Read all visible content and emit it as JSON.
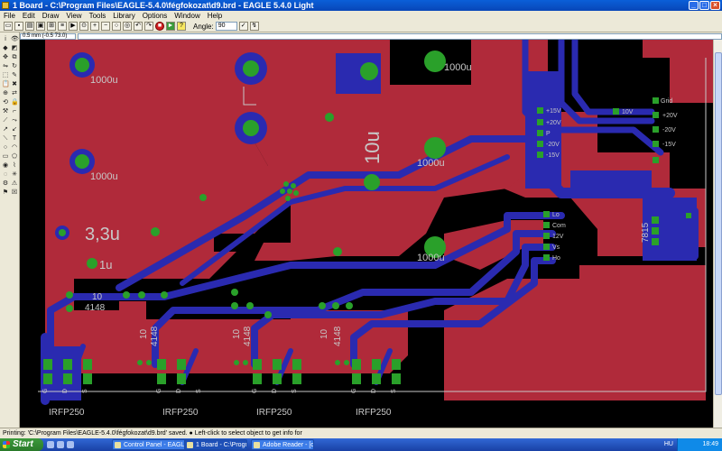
{
  "window": {
    "title": "1 Board - C:\\Program Files\\EAGLE-5.4.0\\fégfokozat\\d9.brd - EAGLE 5.4.0 Light"
  },
  "menu": [
    "File",
    "Edit",
    "Draw",
    "View",
    "Tools",
    "Library",
    "Options",
    "Window",
    "Help"
  ],
  "toolbar": {
    "angle_label": "Angle:",
    "angle_value": "90",
    "icons": [
      "open-icon",
      "save-icon",
      "print-icon",
      "cam-icon",
      "schematic-icon",
      "script-icon",
      "run-icon",
      "zoom-fit-icon",
      "zoom-in-icon",
      "zoom-out-icon",
      "zoom-redraw-icon",
      "zoom-select-icon",
      "undo-icon",
      "redo-icon",
      "stop-icon",
      "go-icon",
      "help-icon",
      "drc-icon",
      "erc-icon"
    ]
  },
  "coordinates": {
    "display": "0.5 mm (-0.5 73.0)"
  },
  "status": {
    "text": "Printing: 'C:\\Program Files\\EAGLE-5.4.0\\fégfokozat\\d9.brd' saved.   ● Left-click to select object to get info for"
  },
  "taskbar": {
    "start_label": "Start",
    "tasks": [
      "Control Panel - EAGL...",
      "1 Board - C:\\Program ...",
      "Adobe Reader - [dat..."
    ],
    "language": "HU",
    "clock": "18:49"
  },
  "pcb": {
    "colors": {
      "background": "#000000",
      "top_copper": "#b02a3a",
      "bottom_copper": "#2a2ab0",
      "pad": "#2aa02a",
      "label": "#c8c8c8"
    },
    "labels": {
      "cap_1000u_a": "1000u",
      "cap_1000u_b": "1000u",
      "cap_1000u_c": "1000u",
      "cap_1000u_d": "1000u",
      "cap_1000u_e": "1000u",
      "cap_10u": "10u",
      "cap_3_3u": "3,3u",
      "cap_1u": "1u",
      "res_10_a": "10",
      "diode_4148_a": "4148",
      "res_10_b": "10",
      "diode_4148_b": "4148",
      "res_10_c": "10",
      "diode_4148_c": "4148",
      "res_10_d": "10",
      "diode_4148_d": "4148",
      "reg_7815": "7815",
      "mosfet_1": "IRFP250",
      "mosfet_2": "IRFP250",
      "mosfet_3": "IRFP250",
      "mosfet_4": "IRFP250",
      "conn_15v": "+15V",
      "conn_20v": "+20V",
      "conn_p": "P",
      "conn_m20v": "-20V",
      "conn_m15v": "-15V",
      "conn_10v": "10V",
      "conn_grid": "Grid",
      "conn_r20v": "+20V",
      "conn_rm20v": "-20V",
      "conn_rm15v": "-15V",
      "conn_lo": "Lo",
      "conn_com": "Com",
      "conn_12v": "12V",
      "conn_vs": "Vs",
      "conn_ho": "Ho",
      "pin_g1": "G",
      "pin_d1": "D",
      "pin_s1": "S",
      "pin_g2": "G",
      "pin_d2": "D",
      "pin_s2": "S",
      "pin_g3": "G",
      "pin_d3": "D",
      "pin_s3": "S",
      "pin_g4": "G",
      "pin_d4": "D",
      "pin_s4": "S"
    }
  }
}
